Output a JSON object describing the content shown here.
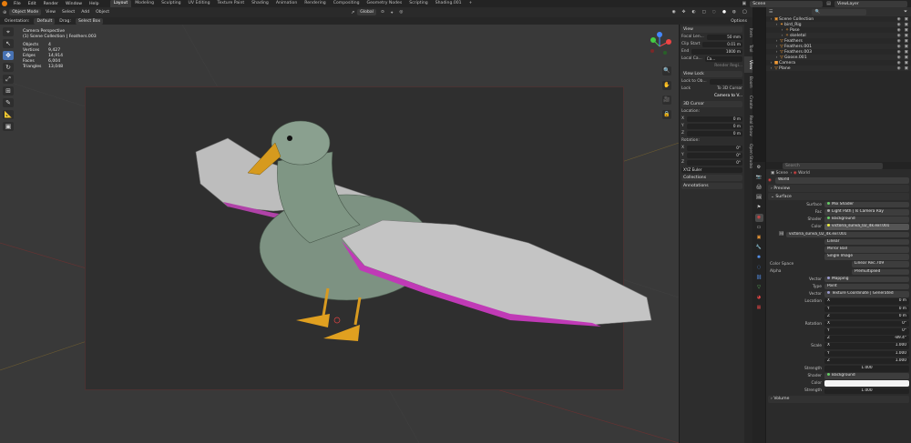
{
  "menus": [
    "File",
    "Edit",
    "Render",
    "Window",
    "Help"
  ],
  "workspaces": [
    {
      "label": "Layout",
      "active": true
    },
    {
      "label": "Modeling"
    },
    {
      "label": "Sculpting"
    },
    {
      "label": "UV Editing"
    },
    {
      "label": "Texture Paint"
    },
    {
      "label": "Shading"
    },
    {
      "label": "Animation"
    },
    {
      "label": "Rendering"
    },
    {
      "label": "Compositing"
    },
    {
      "label": "Geometry Nodes"
    },
    {
      "label": "Scripting"
    },
    {
      "label": "Shading.001"
    },
    {
      "label": "+"
    }
  ],
  "topright": {
    "scene": "Scene",
    "viewlayer": "ViewLayer"
  },
  "vpheader": {
    "mode": "Object Mode",
    "view": "View",
    "select": "Select",
    "add": "Add",
    "object": "Object",
    "orientation_label": "Orientation:",
    "orientation": "Default",
    "drag_label": "Drag:",
    "drag": "Select Box",
    "transform": "Global",
    "options": "Options"
  },
  "overlay": {
    "line1": "Camera Perspective",
    "line2": "(1) Scene Collection | Feathers.003",
    "stats": [
      {
        "k": "Objects",
        "v": "4"
      },
      {
        "k": "Vertices",
        "v": "9,427"
      },
      {
        "k": "Edges",
        "v": "14,914"
      },
      {
        "k": "Faces",
        "v": "6,004"
      },
      {
        "k": "Triangles",
        "v": "13,048"
      }
    ]
  },
  "npanel": {
    "view_title": "View",
    "focal": "Focal Len...",
    "focal_v": "50 mm",
    "clip_label": "Clip Start",
    "clip_v": "0.01 m",
    "end_label": "End",
    "end_v": "1000 m",
    "localcam": "Local Ca...",
    "localcam_v": "Ca...",
    "render_region": "Render Regi...",
    "viewlock_title": "View Lock",
    "lock_obj": "Lock to Ob...",
    "lock": "Lock",
    "to3d": "To 3D Cursor",
    "camview": "Camera to V...",
    "cursor_title": "3D Cursor",
    "location": "Location:",
    "x": "X",
    "y": "Y",
    "z": "Z",
    "loc_x": "0 m",
    "loc_y": "0 m",
    "loc_z": "0 m",
    "rotation": "Rotation:",
    "rot_x": "0°",
    "rot_y": "0°",
    "rot_z": "0°",
    "euler": "XYZ Euler",
    "collections": "Collections",
    "annotations": "Annotations"
  },
  "ntabs": [
    "Item",
    "Tool",
    "View",
    "Boom",
    "Create",
    "Real Snow",
    "Open Studio"
  ],
  "outliner": {
    "rows": [
      {
        "indent": 0,
        "label": "Scene Collection",
        "icon": "▣"
      },
      {
        "indent": 1,
        "label": "bird_Rig",
        "icon": "✦"
      },
      {
        "indent": 2,
        "label": "Pose",
        "icon": "✧"
      },
      {
        "indent": 2,
        "label": "skeletal",
        "icon": "✧"
      },
      {
        "indent": 1,
        "label": "Feathers",
        "icon": "▽"
      },
      {
        "indent": 1,
        "label": "Feathers.001",
        "icon": "▽"
      },
      {
        "indent": 1,
        "label": "Feathers.003",
        "icon": "▽"
      },
      {
        "indent": 1,
        "label": "Goose.001",
        "icon": "▽"
      },
      {
        "indent": 0,
        "label": "Camera",
        "icon": "■"
      },
      {
        "indent": 0,
        "label": "Plane",
        "icon": "▽"
      }
    ]
  },
  "props": {
    "search_placeholder": "Search",
    "breadcrumb_scene": "Scene",
    "breadcrumb_world": "World",
    "world_name": "World",
    "preview": "Preview",
    "surface": "Surface",
    "surface_label": "Surface",
    "surface_v": "Mix Shader",
    "fac_label": "Fac",
    "fac_v": "Light Path | Is Camera Ray",
    "shader_label": "Shader",
    "shader_v": "Background",
    "color_label": "Color",
    "color_v": "victoria_sunva_02_4k.exr.001",
    "image_name": "victoria_sunva_02_4k.exr.001",
    "interp": "Linear",
    "proj": "Mirror Ball",
    "ext": "Single Image",
    "colorspace_label": "Color Space",
    "colorspace_v": "Linear Rec.709",
    "alpha_label": "Alpha",
    "alpha_v": "Premultiplied",
    "vector_label": "Vector",
    "vector_v": "Mapping",
    "type_label": "Type",
    "type_v": "Point",
    "vector2_label": "Vector",
    "vector2_v": "Texture Coordinate | Generated",
    "location_label": "Location",
    "x": "X",
    "y": "Y",
    "z": "Z",
    "loc_x": "0 m",
    "loc_y": "0 m",
    "loc_z": "0 m",
    "rotation_label": "Rotation",
    "rot_x": "0°",
    "rot_y": "0°",
    "rot_z": "-89.4°",
    "scale_label": "Scale",
    "scale_x": "1.000",
    "scale_y": "1.000",
    "scale_z": "1.000",
    "strength_label": "Strength",
    "strength_v": "1.000",
    "shader2_label": "Shader",
    "shader2_v": "Background",
    "color2_label": "Color",
    "strength2_label": "Strength",
    "strength2_v": "1.000",
    "volume": "Volume"
  },
  "colors": {
    "accent": "#4772b3",
    "orange": "#e87d0d",
    "active_tab": "#3a3a3a"
  }
}
